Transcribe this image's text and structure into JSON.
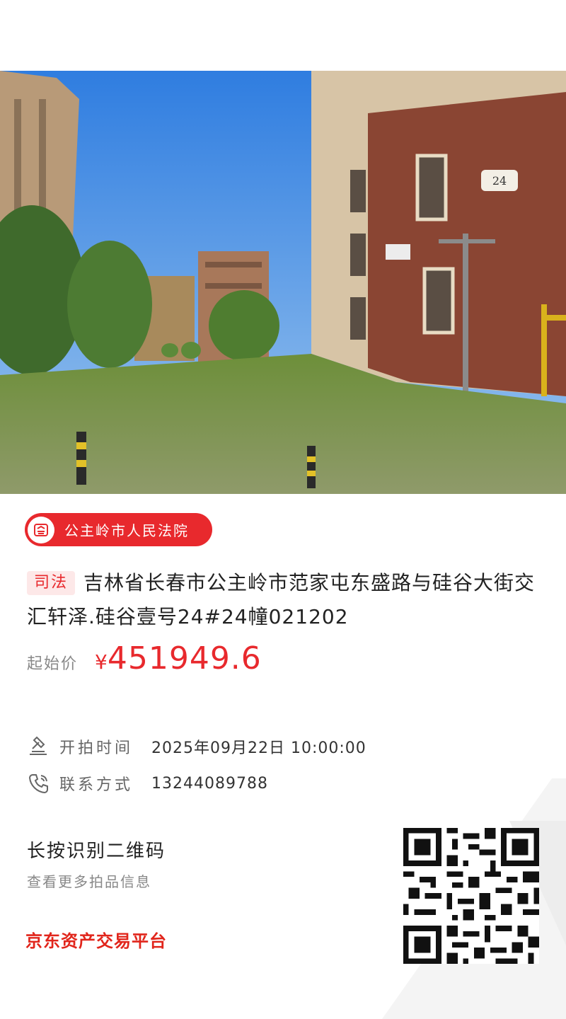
{
  "photo": {
    "icon": "property-photo",
    "building_number": "24"
  },
  "court": {
    "name": "公主岭市人民法院",
    "icon": "court-icon"
  },
  "listing": {
    "tag": "司法",
    "title": "吉林省长春市公主岭市范家屯东盛路与硅谷大街交汇轩泽.硅谷壹号24#24幢021202"
  },
  "price": {
    "label": "起始价",
    "symbol": "¥",
    "value": "451949.6"
  },
  "info": {
    "auction_time_label": "开拍时间",
    "auction_time_value": "2025年09月22日 10:00:00",
    "contact_label": "联系方式",
    "contact_value": "13244089788"
  },
  "qr": {
    "title": "长按识别二维码",
    "subtitle": "查看更多拍品信息"
  },
  "platform": {
    "name": "京东资产交易平台"
  },
  "colors": {
    "accent": "#e8292d",
    "brand": "#e1251b"
  }
}
